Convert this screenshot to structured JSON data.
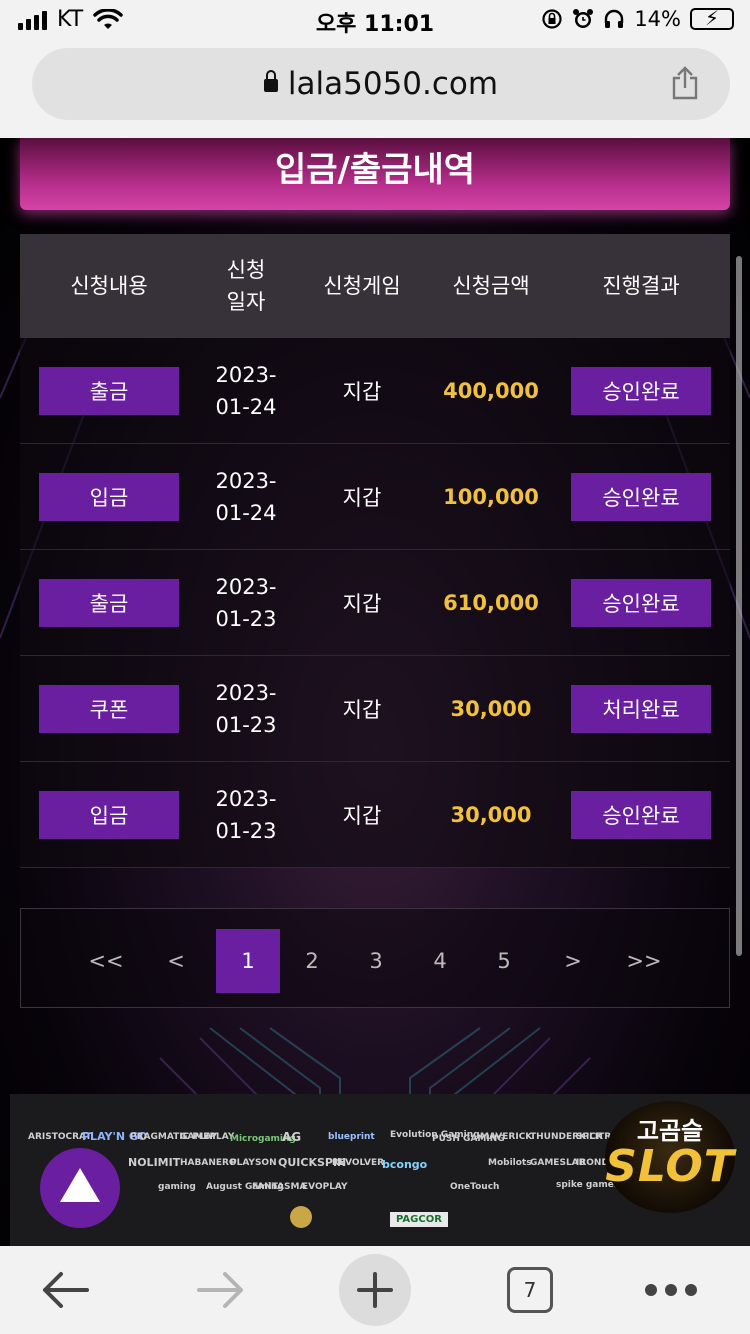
{
  "status_bar": {
    "carrier": "KT",
    "time": "오후 11:01",
    "battery": "14%"
  },
  "browser": {
    "url": "lala5050.com",
    "tab_count": "7"
  },
  "page": {
    "title": "입금/출금내역",
    "table": {
      "headers": {
        "content": "신청내용",
        "date_line1": "신청",
        "date_line2": "일자",
        "game": "신청게임",
        "amount": "신청금액",
        "result": "진행결과"
      },
      "rows": [
        {
          "type": "출금",
          "date1": "2023-",
          "date2": "01-24",
          "game": "지갑",
          "amount": "400,000",
          "status": "승인완료"
        },
        {
          "type": "입금",
          "date1": "2023-",
          "date2": "01-24",
          "game": "지갑",
          "amount": "100,000",
          "status": "승인완료"
        },
        {
          "type": "출금",
          "date1": "2023-",
          "date2": "01-23",
          "game": "지갑",
          "amount": "610,000",
          "status": "승인완료"
        },
        {
          "type": "쿠폰",
          "date1": "2023-",
          "date2": "01-23",
          "game": "지갑",
          "amount": "30,000",
          "status": "처리완료"
        },
        {
          "type": "입금",
          "date1": "2023-",
          "date2": "01-23",
          "game": "지갑",
          "amount": "30,000",
          "status": "승인완료"
        }
      ]
    },
    "pagination": {
      "first": "<<",
      "prev": "<",
      "pages": [
        "1",
        "2",
        "3",
        "4",
        "5"
      ],
      "next": ">",
      "last": ">>",
      "current": "1"
    },
    "partners": {
      "logos": [
        "ARISTOCRAT",
        "PLAY'N GO",
        "PRAGMATIC PLAY",
        "GAMEPLAY",
        "Microgaming",
        "AG",
        "blueprint",
        "Evolution Gaming",
        "PUSH GAMING",
        "MAVERICK",
        "THUNDERKICK",
        "SPLITROCK",
        "NOLIMIT",
        "HABANERO",
        "PLAYSON",
        "QUICKSPIN",
        "REVOLVER",
        "bcongo",
        "Mobilots",
        "GAMESLAB",
        "IRONDOG",
        "gaming",
        "August Gaming",
        "FANTASMA",
        "EVOPLAY",
        "OneTouch",
        "spike games",
        "PAGCOR"
      ],
      "slot_badge_top": "고곰슬",
      "slot_badge_bottom": "SLOT"
    }
  },
  "colors": {
    "accent_purple": "#6a1ea0",
    "amount_gold": "#f2c13a",
    "title_magenta": "#b22c88"
  }
}
